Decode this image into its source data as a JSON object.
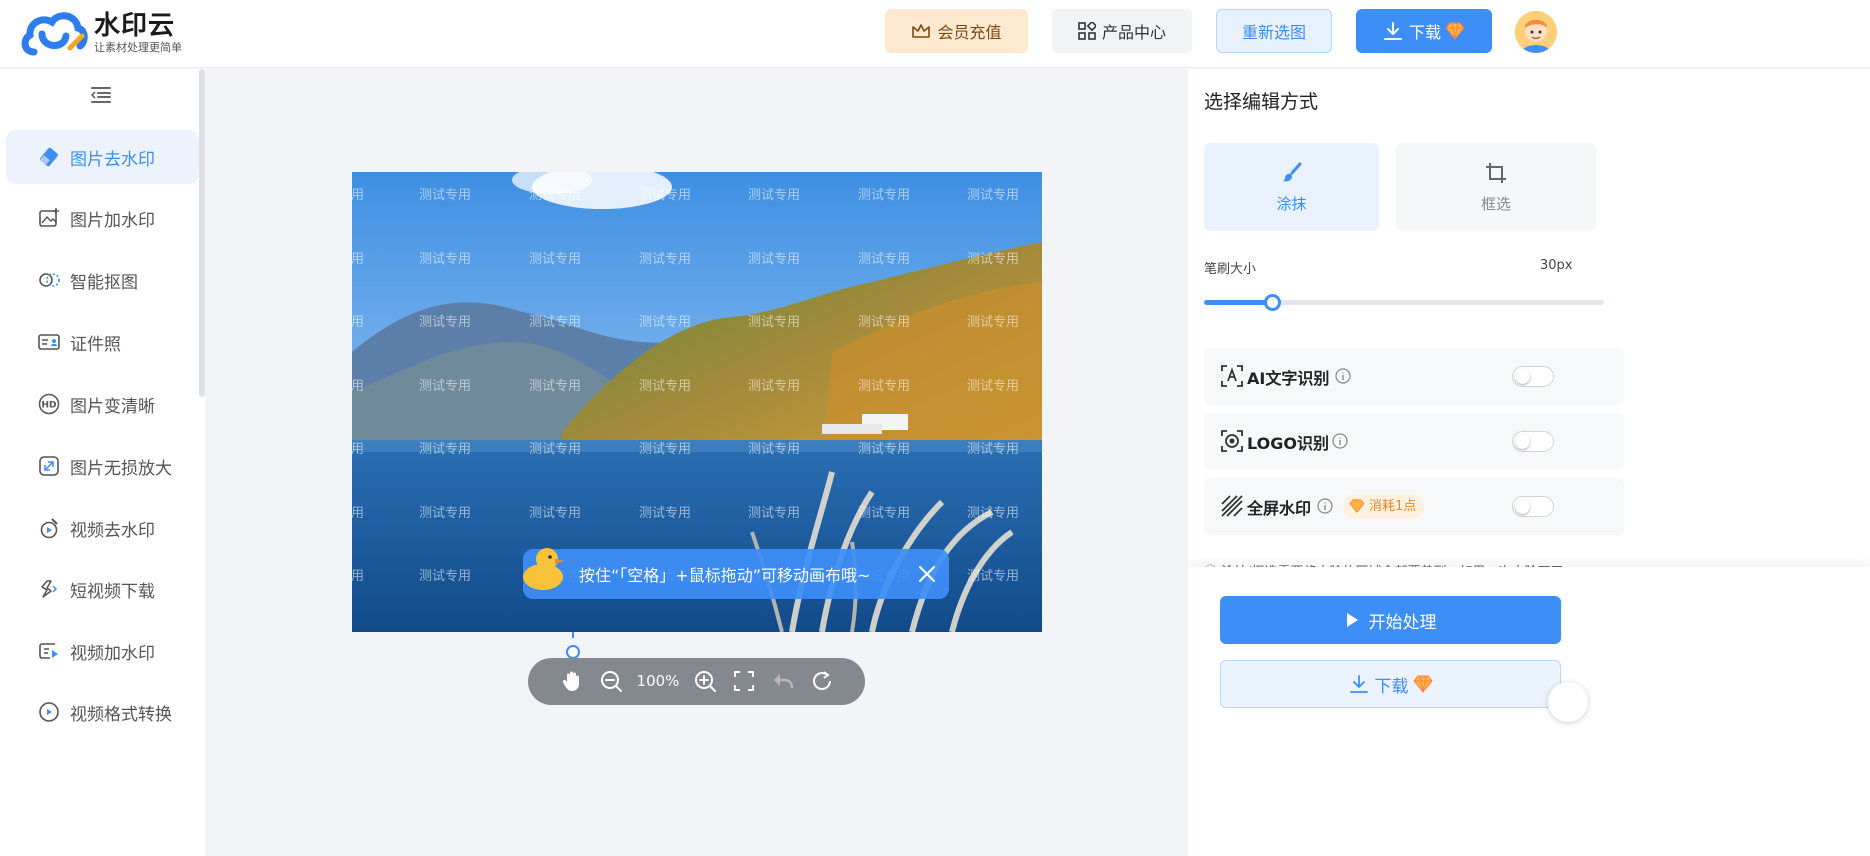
{
  "app": {
    "name": "水印云",
    "slogan": "让素材处理更简单"
  },
  "header": {
    "member_label": "会员充值",
    "product_label": "产品中心",
    "reselect_label": "重新选图",
    "download_label": "下载"
  },
  "sidebar": {
    "items": [
      {
        "label": "图片去水印",
        "icon": "eraser-icon",
        "active": true
      },
      {
        "label": "图片加水印",
        "icon": "image-add-icon"
      },
      {
        "label": "智能抠图",
        "icon": "cutout-icon"
      },
      {
        "label": "证件照",
        "icon": "id-card-icon"
      },
      {
        "label": "图片变清晰",
        "icon": "hd-icon"
      },
      {
        "label": "图片无损放大",
        "icon": "enlarge-icon"
      },
      {
        "label": "视频去水印",
        "icon": "video-eraser-icon"
      },
      {
        "label": "短视频下载",
        "icon": "link-icon"
      },
      {
        "label": "视频加水印",
        "icon": "video-add-icon"
      },
      {
        "label": "视频格式转换",
        "icon": "convert-icon"
      }
    ]
  },
  "canvas": {
    "watermark_text": "测试专用",
    "tip_text": "按住“「空格」+鼠标拖动”可移动画布哦~",
    "zoom": "100%"
  },
  "panel": {
    "title": "选择编辑方式",
    "modes": [
      {
        "label": "涂抹",
        "icon": "brush-icon",
        "active": true
      },
      {
        "label": "框选",
        "icon": "crop-icon"
      }
    ],
    "brush_label": "笔刷大小",
    "brush_value": "30px",
    "brush_fraction": 0.17,
    "options": [
      {
        "label": "AI文字识别",
        "icon": "text-scan-icon"
      },
      {
        "label": "LOGO识别",
        "icon": "logo-scan-icon"
      },
      {
        "label": "全屏水印",
        "icon": "hatch-icon",
        "badge": "消耗1点"
      }
    ],
    "note": "ⓘ 涂抹/框选需要将去除的区域全部覆盖到，如果一次去除不干",
    "start_label": "开始处理",
    "download_label": "下载"
  },
  "colors": {
    "accent": "#3d8ef7",
    "member": "#fde9cf",
    "badge": "#e8892b"
  }
}
